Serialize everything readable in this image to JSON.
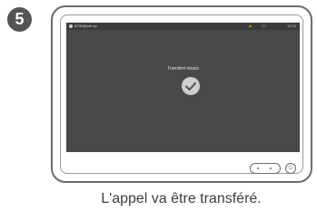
{
  "step": {
    "number": "5"
  },
  "screen": {
    "status_bar": {
      "user": "8230@mtk.sp",
      "icons": [
        "wifi-icon",
        "battery-icon"
      ],
      "time": "10:15"
    },
    "message": "Transfert réussi",
    "icon": "checkmark-icon"
  },
  "device": {
    "home_button_icon": "home-pill-icon",
    "side_button_icon": "power-icon"
  },
  "caption": "L'appel va être transféré."
}
